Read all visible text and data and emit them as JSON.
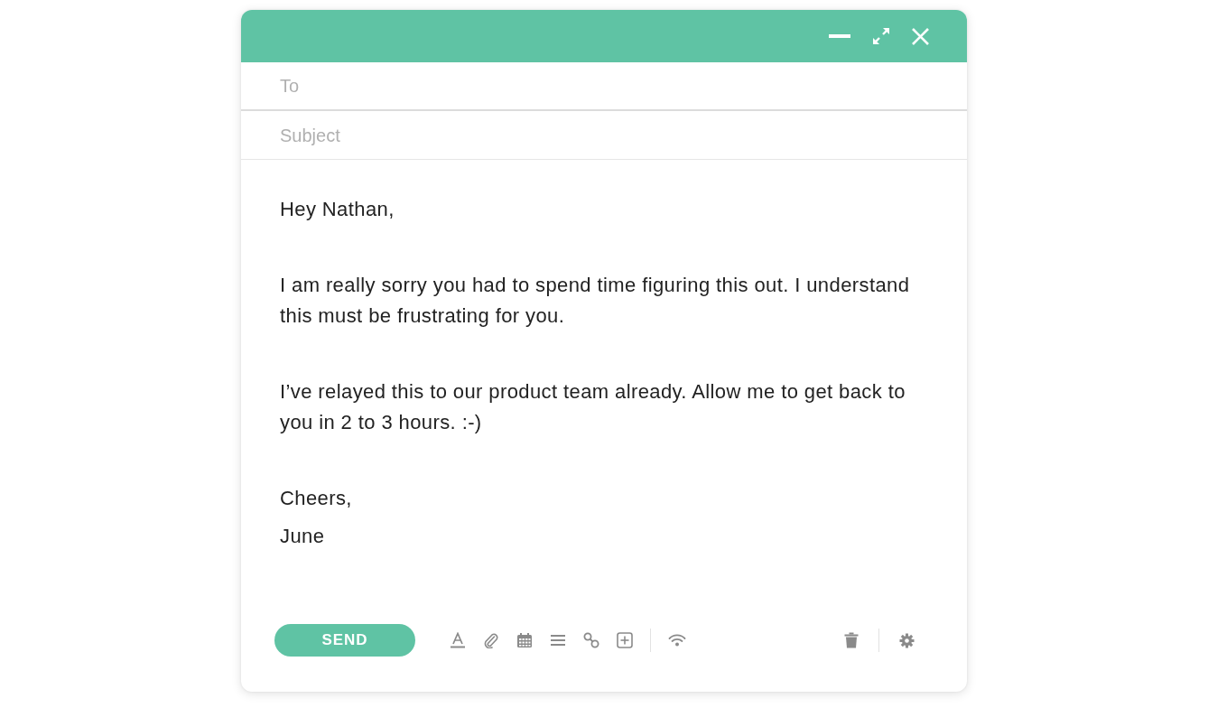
{
  "compose": {
    "to": {
      "placeholder": "To"
    },
    "subject": {
      "placeholder": "Subject"
    },
    "body": [
      "Hey Nathan,",
      "I am really sorry you had to spend time figuring this out. I understand this must be frustrating for you.",
      "I’ve relayed this to our product team already. Allow me to get back to you in 2 to 3 hours. :-)"
    ],
    "signature": [
      "Cheers,",
      "June"
    ]
  },
  "footer": {
    "send_button": "SEND"
  }
}
